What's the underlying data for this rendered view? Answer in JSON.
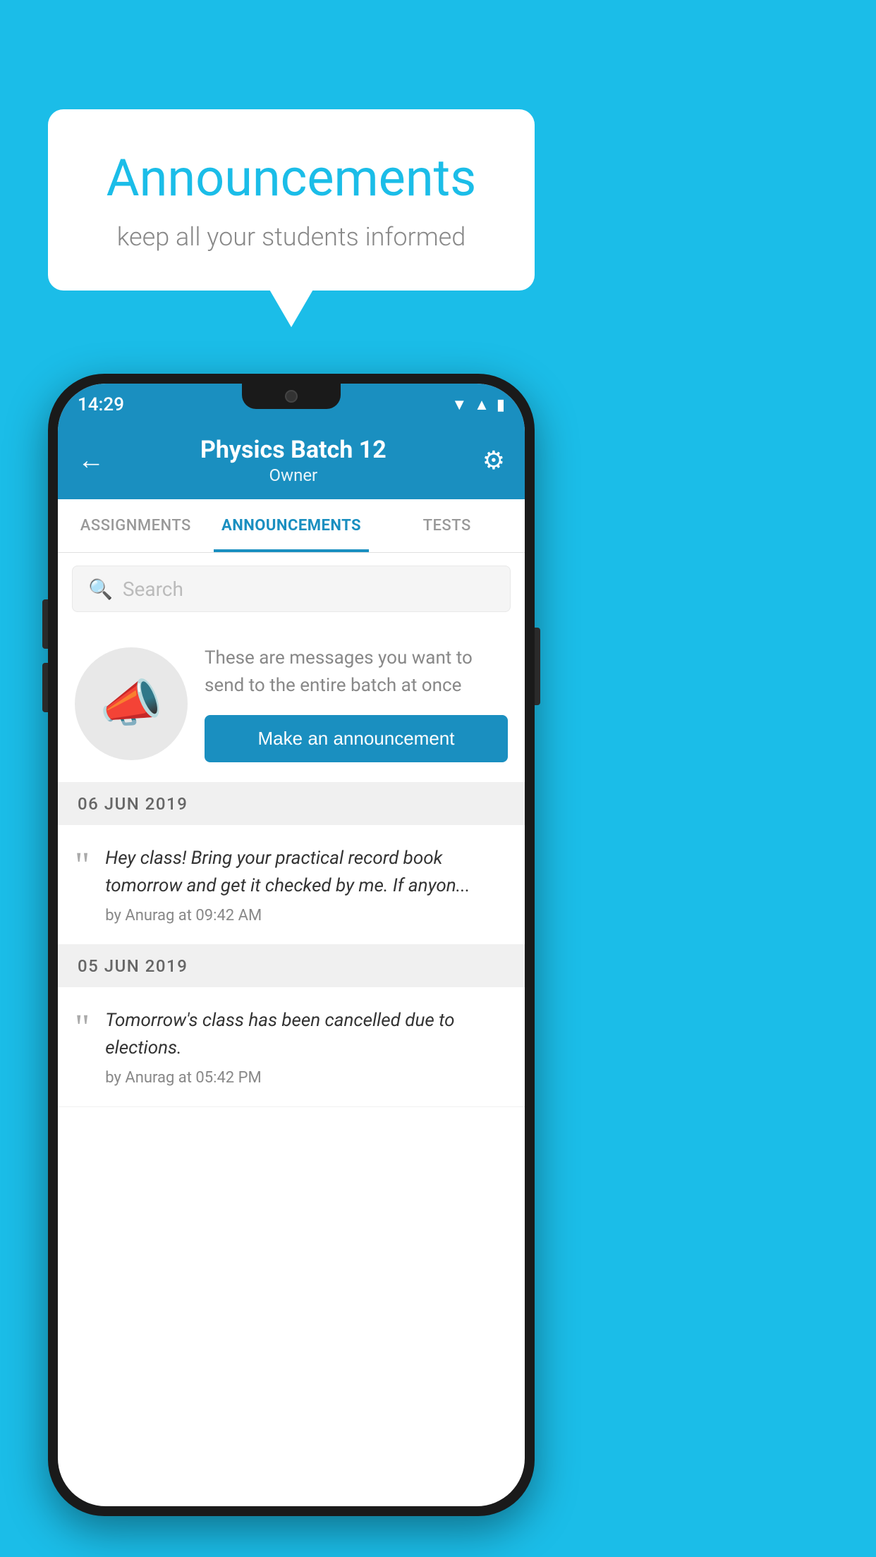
{
  "background_color": "#1bbde8",
  "bubble": {
    "title": "Announcements",
    "subtitle": "keep all your students informed"
  },
  "phone": {
    "status_bar": {
      "time": "14:29",
      "icons": [
        "wifi",
        "signal",
        "battery"
      ]
    },
    "header": {
      "title": "Physics Batch 12",
      "subtitle": "Owner",
      "back_label": "←",
      "settings_label": "⚙"
    },
    "tabs": [
      {
        "label": "ASSIGNMENTS",
        "active": false
      },
      {
        "label": "ANNOUNCEMENTS",
        "active": true
      },
      {
        "label": "TESTS",
        "active": false
      },
      {
        "label": "...",
        "active": false
      }
    ],
    "search": {
      "placeholder": "Search"
    },
    "announcement_prompt": {
      "description": "These are messages you want to send to the entire batch at once",
      "button_label": "Make an announcement"
    },
    "date_sections": [
      {
        "date": "06  JUN  2019",
        "messages": [
          {
            "text": "Hey class! Bring your practical record book tomorrow and get it checked by me. If anyon...",
            "meta": "by Anurag at 09:42 AM"
          }
        ]
      },
      {
        "date": "05  JUN  2019",
        "messages": [
          {
            "text": "Tomorrow's class has been cancelled due to elections.",
            "meta": "by Anurag at 05:42 PM"
          }
        ]
      }
    ]
  }
}
